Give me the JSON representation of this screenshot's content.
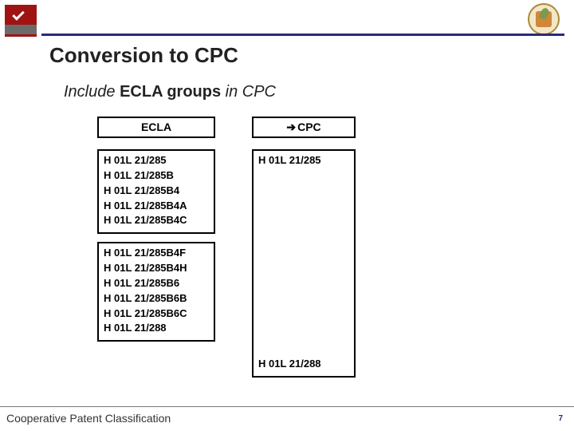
{
  "title": "Conversion to CPC",
  "subtitle_pre": "Include ",
  "subtitle_strong": "ECLA groups",
  "subtitle_post": " in CPC",
  "headers": {
    "ecla": "ECLA",
    "cpc": "CPC"
  },
  "ecla_group1": [
    "H 01L 21/285",
    "H 01L 21/285B",
    "H 01L 21/285B4",
    "H 01L 21/285B4A",
    "H 01L 21/285B4C"
  ],
  "ecla_group2": [
    "H 01L 21/285B4F",
    "H 01L 21/285B4H",
    "H 01L 21/285B6",
    "H 01L 21/285B6B",
    "H 01L 21/285B6C",
    "H 01L 21/288"
  ],
  "cpc_first": "H 01L 21/285",
  "cpc_last": "H 01L 21/288",
  "footer": "Cooperative Patent Classification",
  "page": "7"
}
